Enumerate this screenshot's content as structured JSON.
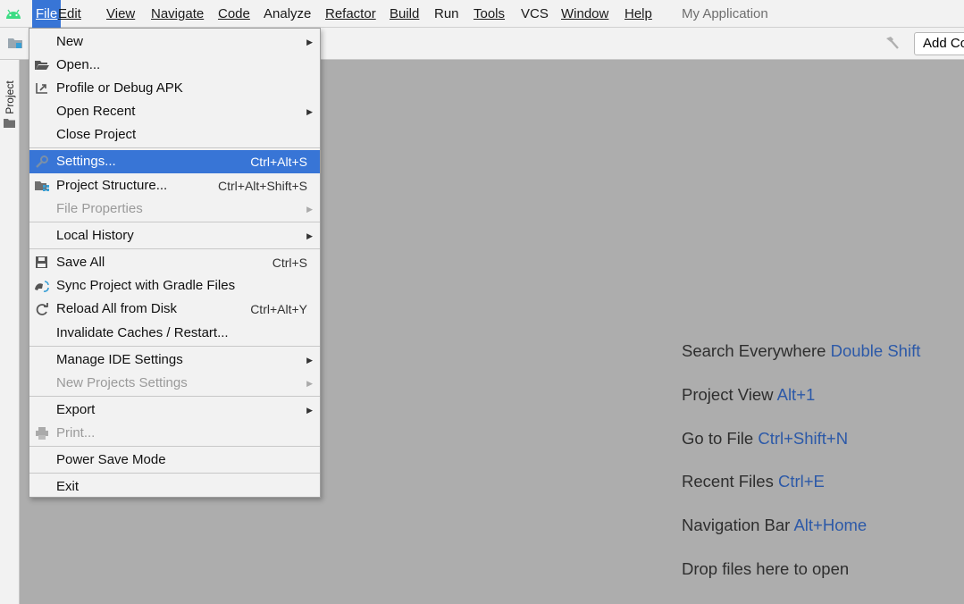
{
  "menubar": {
    "items": [
      {
        "label": "File",
        "active": true
      },
      {
        "label": "Edit"
      },
      {
        "label": "View"
      },
      {
        "label": "Navigate"
      },
      {
        "label": "Code"
      },
      {
        "label": "Analyze"
      },
      {
        "label": "Refactor"
      },
      {
        "label": "Build"
      },
      {
        "label": "Run"
      },
      {
        "label": "Tools"
      },
      {
        "label": "VCS"
      },
      {
        "label": "Window"
      },
      {
        "label": "Help"
      }
    ],
    "app_title": "My Application"
  },
  "toolbar": {
    "add_configuration_label": "Add Configuration..."
  },
  "left_strip": {
    "project_tab_label": "Project"
  },
  "file_menu": {
    "items": [
      {
        "label": "New",
        "submenu": true
      },
      {
        "label": "Open...",
        "icon": "folder-open-icon"
      },
      {
        "label": "Profile or Debug APK",
        "icon": "profile-debug-icon"
      },
      {
        "label": "Open Recent",
        "submenu": true
      },
      {
        "label": "Close Project"
      },
      {
        "label": "Settings...",
        "shortcut": "Ctrl+Alt+S",
        "icon": "wrench-icon",
        "selected": true
      },
      {
        "label": "Project Structure...",
        "shortcut": "Ctrl+Alt+Shift+S",
        "icon": "project-structure-icon"
      },
      {
        "label": "File Properties",
        "submenu": true,
        "disabled": true
      },
      {
        "label": "Local History",
        "submenu": true
      },
      {
        "label": "Save All",
        "shortcut": "Ctrl+S",
        "icon": "save-icon"
      },
      {
        "label": "Sync Project with Gradle Files",
        "icon": "gradle-sync-icon"
      },
      {
        "label": "Reload All from Disk",
        "shortcut": "Ctrl+Alt+Y",
        "icon": "reload-icon"
      },
      {
        "label": "Invalidate Caches / Restart..."
      },
      {
        "label": "Manage IDE Settings",
        "submenu": true
      },
      {
        "label": "New Projects Settings",
        "submenu": true,
        "disabled": true
      },
      {
        "label": "Export",
        "submenu": true
      },
      {
        "label": "Print...",
        "icon": "print-icon",
        "disabled": true
      },
      {
        "label": "Power Save Mode"
      },
      {
        "label": "Exit"
      }
    ]
  },
  "welcome_hints": [
    {
      "text": "Search Everywhere ",
      "shortcut": "Double Shift"
    },
    {
      "text": "Project View ",
      "shortcut": "Alt+1"
    },
    {
      "text": "Go to File ",
      "shortcut": "Ctrl+Shift+N"
    },
    {
      "text": "Recent Files ",
      "shortcut": "Ctrl+E"
    },
    {
      "text": "Navigation Bar ",
      "shortcut": "Alt+Home"
    },
    {
      "text": "Drop files here to open",
      "shortcut": ""
    }
  ],
  "colors": {
    "accent": "#3875d6",
    "shortcut_blue": "#2c59a8",
    "editor_bg": "#adadad",
    "android_green": "#3ddc84"
  }
}
